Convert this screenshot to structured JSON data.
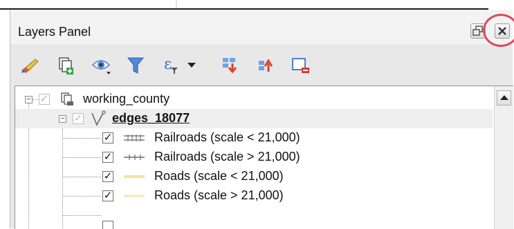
{
  "panel": {
    "title": "Layers Panel"
  },
  "toolbar": {
    "tools": [
      {
        "name": "style-brush-icon"
      },
      {
        "name": "add-group-icon"
      },
      {
        "name": "visibility-eye-icon"
      },
      {
        "name": "filter-funnel-icon"
      },
      {
        "name": "expression-filter-icon"
      },
      {
        "name": "expand-all-icon"
      },
      {
        "name": "collapse-all-icon"
      },
      {
        "name": "remove-layer-icon"
      }
    ]
  },
  "tree": {
    "group": {
      "label": "working_county",
      "checked": true
    },
    "layer": {
      "label": "edges_18077",
      "checked": true
    },
    "rules": [
      {
        "label": "Railroads (scale < 21,000)",
        "checked": true,
        "symbol": "rail-double"
      },
      {
        "label": "Railroads (scale > 21,000)",
        "checked": true,
        "symbol": "rail-single"
      },
      {
        "label": "Roads (scale < 21,000)",
        "checked": true,
        "symbol": "road-yellow"
      },
      {
        "label": "Roads (scale > 21,000)",
        "checked": true,
        "symbol": "road-pale"
      }
    ]
  },
  "colors": {
    "highlight_ring": "#e0485a",
    "road_yellow": "#f2e39a",
    "road_pale": "#f3eccb"
  }
}
